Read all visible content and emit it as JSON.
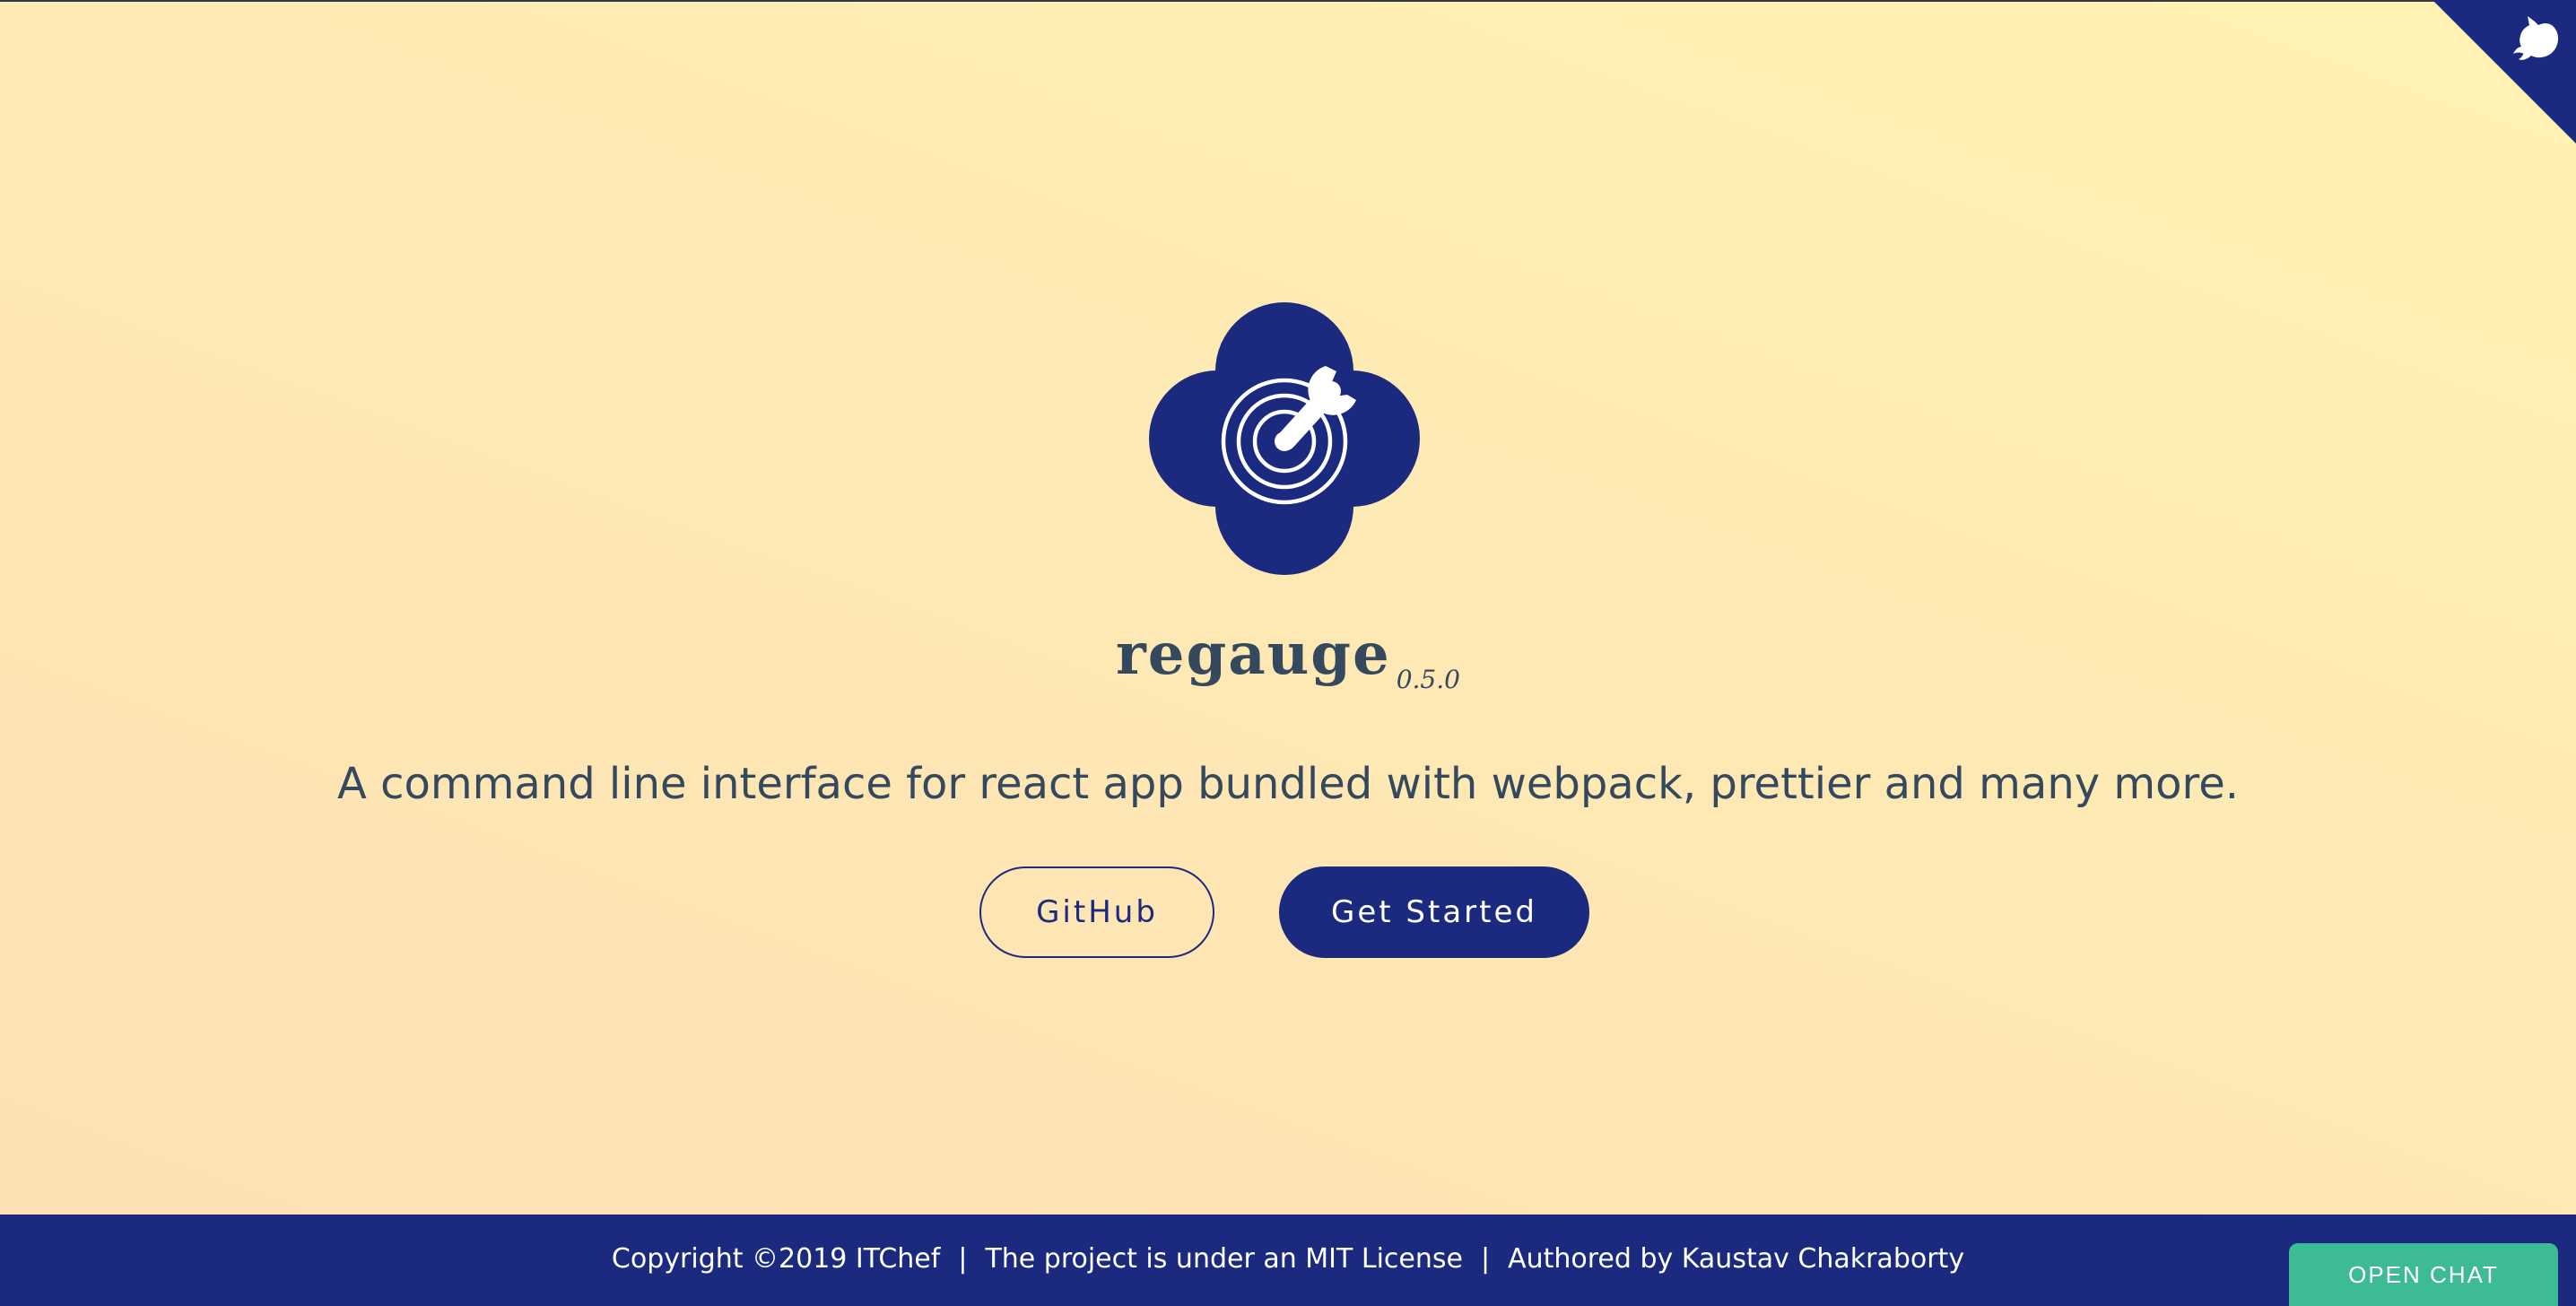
{
  "header": {
    "github_corner_icon": "github-octocat-icon"
  },
  "hero": {
    "logo_icon": "target-wrench-icon",
    "app_name": "regauge",
    "version": "0.5.0",
    "tagline": "A command line interface for react app bundled with webpack, prettier and many more.",
    "buttons": {
      "github_label": "GitHub",
      "get_started_label": "Get Started"
    }
  },
  "footer": {
    "copyright": "Copyright ©2019 ITChef",
    "separator": "|",
    "license": "The project is under an MIT License",
    "author": "Authored by Kaustav Chakraborty"
  },
  "chat": {
    "label": "OPEN CHAT"
  },
  "colors": {
    "primary": "#1b2a7e",
    "text": "#34495e",
    "chat": "#3dbb95",
    "background_start": "#fde0b5",
    "background_end": "#fff3b3"
  }
}
